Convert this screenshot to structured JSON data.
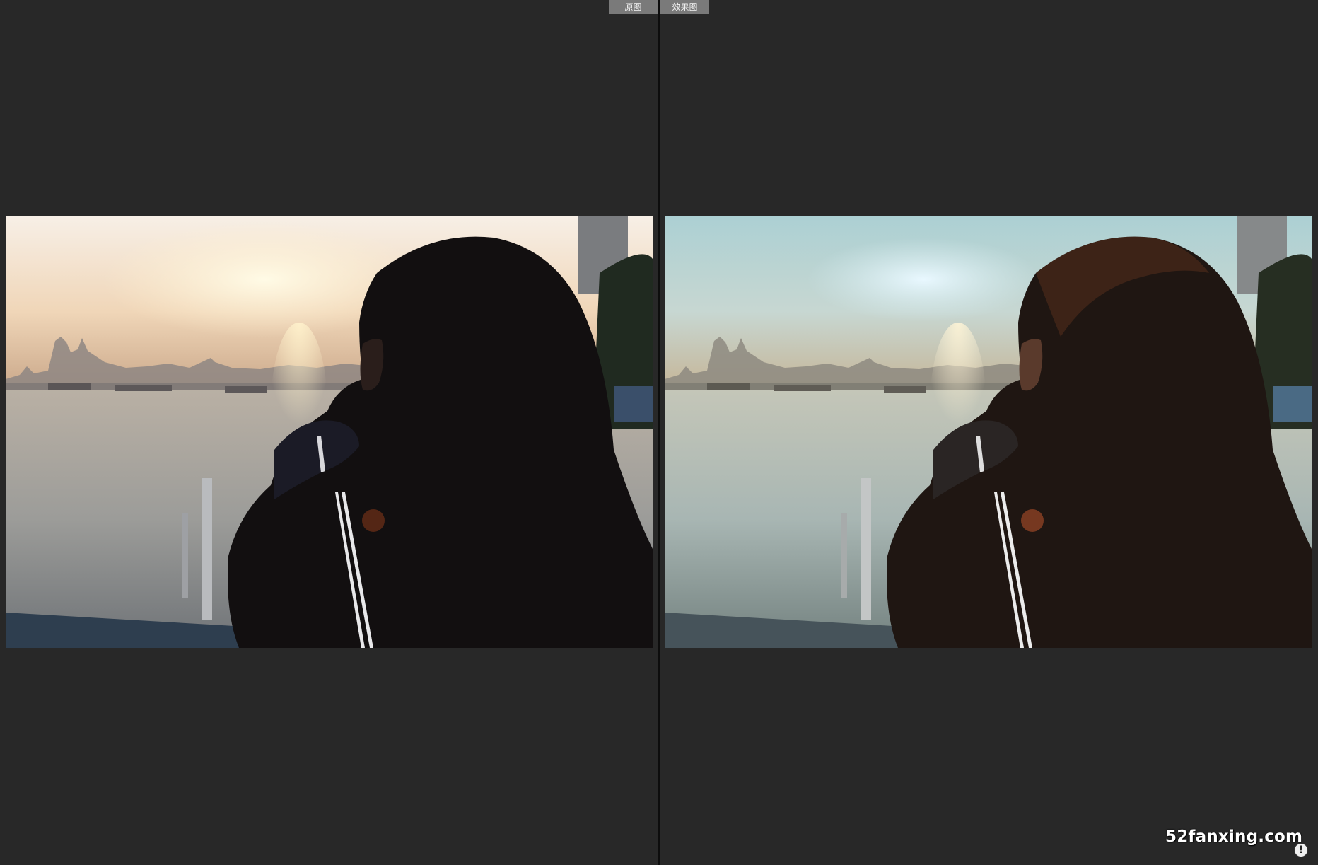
{
  "toolbar": {
    "original_label": "原图",
    "edited_label": "效果图"
  },
  "left_image": {
    "name": "original-photo",
    "sky_top": "#f6ece2",
    "sky_glow": "#fff4dc",
    "sky_haze": "#e9c6a0",
    "water": "#a9a7a2"
  },
  "right_image": {
    "name": "edited-photo",
    "sky_top": "#b5d3d5",
    "sky_glow": "#e8f6ff",
    "sky_haze": "#cdbf9e",
    "water": "#a4b6b3"
  },
  "watermark": {
    "text": "52fanxing.com"
  },
  "info_icon": {
    "icon": "info-icon",
    "glyph": "!"
  },
  "colors": {
    "background": "#282828",
    "divider": "#0d0d0d",
    "label_bg": "#7a7a7a"
  }
}
